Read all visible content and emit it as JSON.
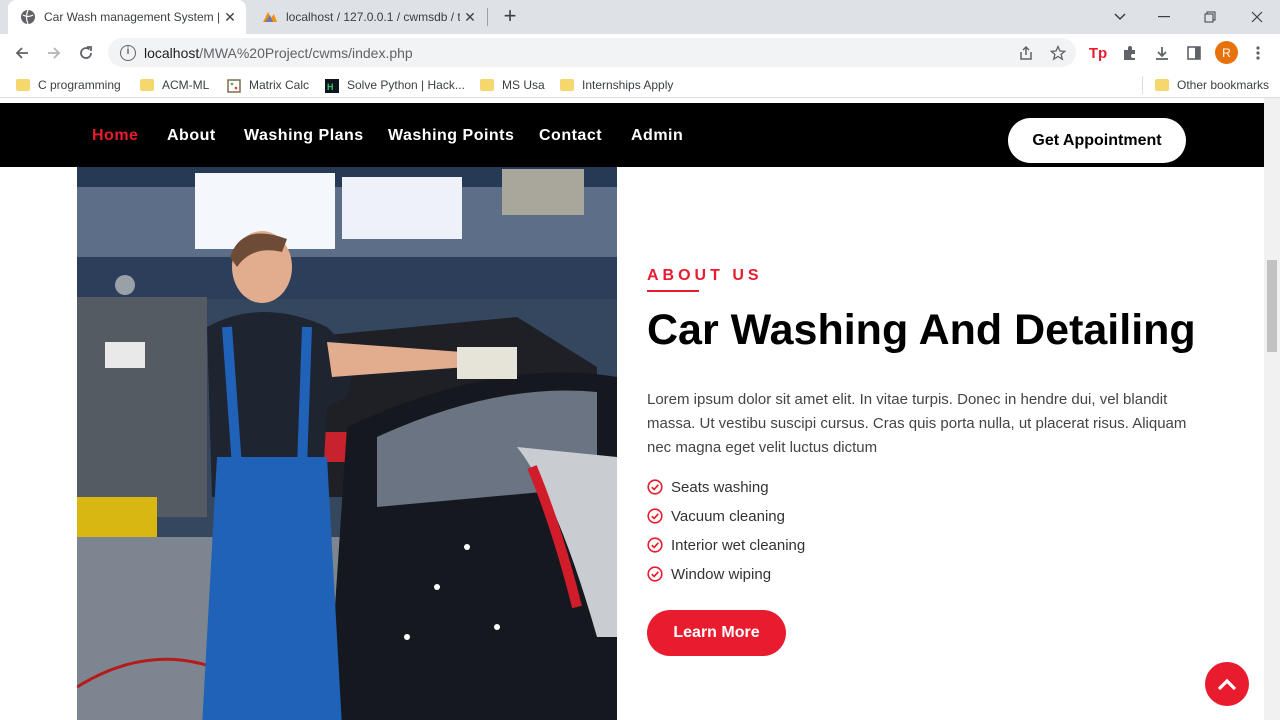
{
  "browser": {
    "tabs": [
      {
        "title": "Car Wash management System |",
        "active": true
      },
      {
        "title": "localhost / 127.0.0.1 / cwmsdb / t",
        "active": false
      }
    ],
    "address": {
      "host": "localhost",
      "path": "/MWA%20Project/cwms/index.php"
    },
    "profile_initial": "R",
    "bookmarks": [
      "C programming",
      "ACM-ML",
      "Matrix Calc",
      "Solve Python | Hack...",
      "MS Usa",
      "Internships Apply"
    ],
    "other_bookmarks": "Other bookmarks"
  },
  "nav": {
    "links": [
      "Home",
      "About",
      "Washing Plans",
      "Washing Points",
      "Contact",
      "Admin"
    ],
    "appointment_label": "Get Appointment"
  },
  "about": {
    "tag": "ABOUT US",
    "title": "Car Washing And Detailing",
    "text": "Lorem ipsum dolor sit amet elit. In vitae turpis. Donec in hendre dui, vel blandit massa. Ut vestibu suscipi cursus. Cras quis porta nulla, ut placerat risus. Aliquam nec magna eget velit luctus dictum",
    "features": [
      "Seats washing",
      "Vacuum cleaning",
      "Interior wet cleaning",
      "Window wiping"
    ],
    "button_label": "Learn More"
  },
  "colors": {
    "accent": "#e81c2e",
    "nav_bg": "#000000"
  }
}
